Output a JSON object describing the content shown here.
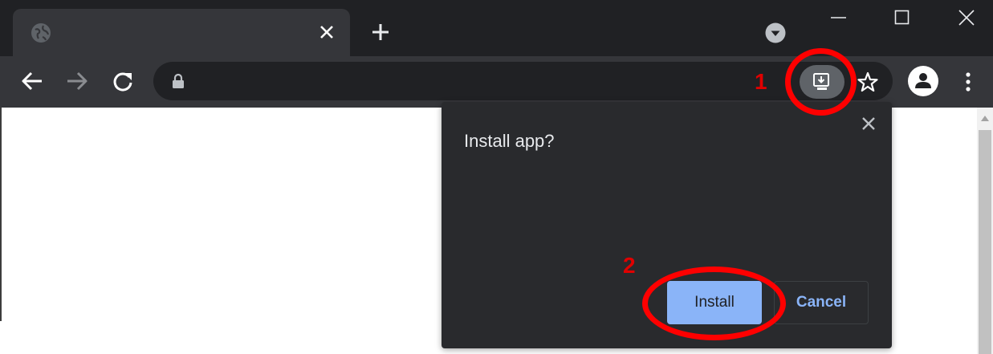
{
  "window": {
    "controls": [
      "minimize",
      "maximize",
      "close"
    ]
  },
  "tab": {
    "favicon": "globe-icon",
    "title": ""
  },
  "toolbar": {
    "url": ""
  },
  "dialog": {
    "title": "Install app?",
    "install_label": "Install",
    "cancel_label": "Cancel"
  },
  "annotations": {
    "step1": "1",
    "step2": "2"
  },
  "colors": {
    "titlebar": "#202124",
    "toolbar": "#35363a",
    "dialog_bg": "#292a2d",
    "primary": "#8ab4f8",
    "annotation": "#ff0000"
  }
}
